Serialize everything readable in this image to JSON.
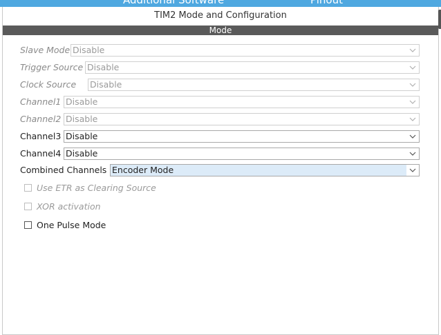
{
  "top_strip": {
    "left_text": "Additional Software",
    "right_text": "Pinout"
  },
  "panel": {
    "title": "TIM2 Mode and Configuration",
    "section": "Mode"
  },
  "fields": [
    {
      "label": "Slave Mode",
      "value": "Disable",
      "enabled": false
    },
    {
      "label": "Trigger Source",
      "value": "Disable",
      "enabled": false
    },
    {
      "label": "Clock Source",
      "value": "Disable",
      "enabled": false
    },
    {
      "label": "Channel1",
      "value": "Disable",
      "enabled": false
    },
    {
      "label": "Channel2",
      "value": "Disable",
      "enabled": false
    },
    {
      "label": "Channel3",
      "value": "Disable",
      "enabled": true
    },
    {
      "label": "Channel4",
      "value": "Disable",
      "enabled": true
    },
    {
      "label": "Combined Channels",
      "value": "Encoder Mode",
      "enabled": true
    }
  ],
  "checkboxes": [
    {
      "label": "Use ETR as Clearing Source",
      "checked": false,
      "enabled": false
    },
    {
      "label": "XOR activation",
      "checked": false,
      "enabled": false
    },
    {
      "label": "One Pulse Mode",
      "checked": false,
      "enabled": true
    }
  ],
  "colors": {
    "accent": "#4fa8e0",
    "section_bar": "#5a5a5a",
    "selection": "#dcebf8"
  }
}
